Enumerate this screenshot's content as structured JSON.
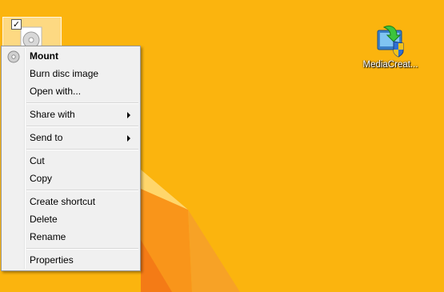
{
  "desktop": {
    "background_color": "#fbb40e",
    "selected_icon": {
      "checkbox_checked": true,
      "icon": "disc-image-file-icon"
    },
    "app_icon": {
      "label": "MediaCreat...",
      "icon": "media-creation-tool-icon"
    }
  },
  "context_menu": {
    "groups": [
      [
        {
          "label": "Mount",
          "bold": true,
          "icon": "disc-icon",
          "submenu": false
        },
        {
          "label": "Burn disc image",
          "bold": false,
          "submenu": false
        },
        {
          "label": "Open with...",
          "bold": false,
          "submenu": false
        }
      ],
      [
        {
          "label": "Share with",
          "bold": false,
          "submenu": true
        }
      ],
      [
        {
          "label": "Send to",
          "bold": false,
          "submenu": true
        }
      ],
      [
        {
          "label": "Cut",
          "bold": false,
          "submenu": false
        },
        {
          "label": "Copy",
          "bold": false,
          "submenu": false
        }
      ],
      [
        {
          "label": "Create shortcut",
          "bold": false,
          "submenu": false
        },
        {
          "label": "Delete",
          "bold": false,
          "submenu": false
        },
        {
          "label": "Rename",
          "bold": false,
          "submenu": false
        }
      ],
      [
        {
          "label": "Properties",
          "bold": false,
          "submenu": false
        }
      ]
    ]
  }
}
